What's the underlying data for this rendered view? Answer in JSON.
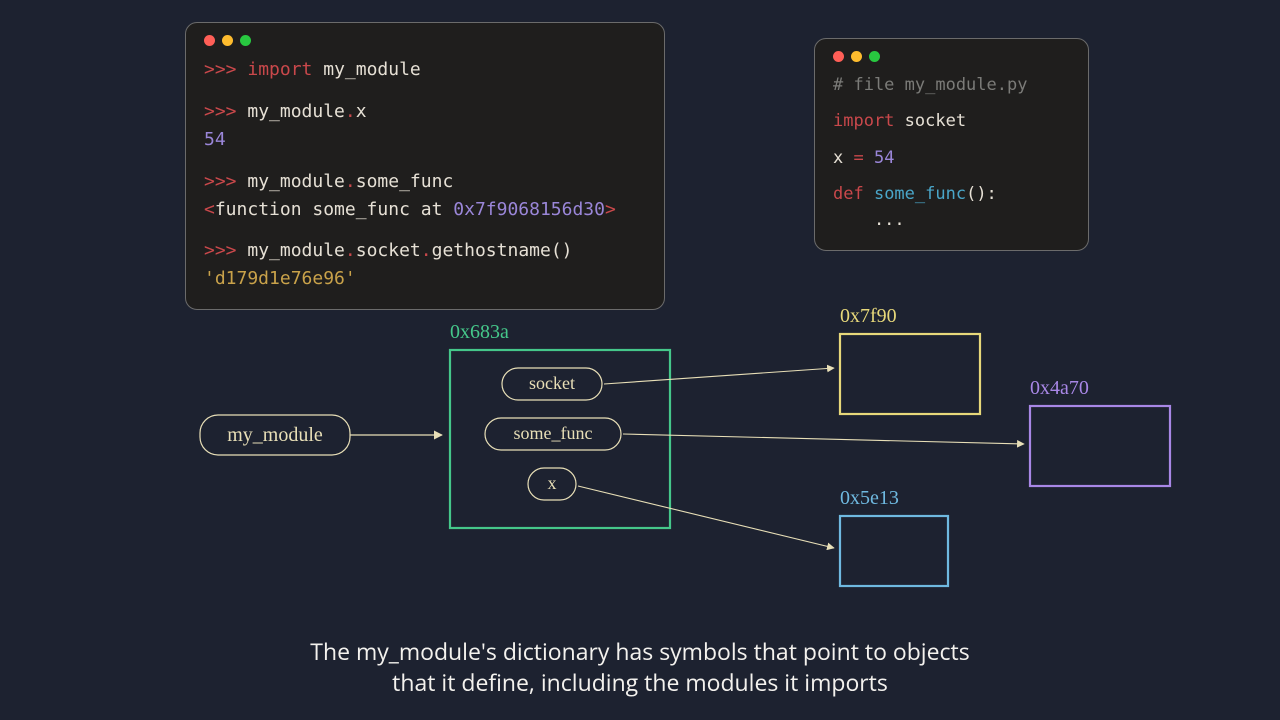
{
  "caption": {
    "line1": "The my_module's dictionary has symbols that point to objects",
    "line2": "that it define, including the modules it imports"
  },
  "repl": {
    "line1": {
      "prompt": ">>> ",
      "kw": "import",
      "rest": " my_module"
    },
    "line2": {
      "prompt": ">>> ",
      "expr": "my_module",
      "dot": ".",
      "attr": "x"
    },
    "line2_out": "54",
    "line3": {
      "prompt": ">>> ",
      "expr": "my_module",
      "dot": ".",
      "attr": "some_func"
    },
    "line3_out": {
      "lt": "<",
      "mid": "function some_func at ",
      "addr": "0x7f9068156d30",
      "gt": ">"
    },
    "line4": {
      "prompt": ">>> ",
      "expr": "my_module",
      "dot1": ".",
      "attr1": "socket",
      "dot2": ".",
      "call": "gethostname",
      "paren": "()"
    },
    "line4_out": "'d179d1e76e96'"
  },
  "file": {
    "comment": "# file my_module.py",
    "imp": {
      "kw": "import",
      "mod": " socket"
    },
    "assign": {
      "name": "x ",
      "op": "=",
      "val": " 54"
    },
    "def": {
      "kw": "def",
      "name": " some_func",
      "sig": "():"
    },
    "body": "    ..."
  },
  "diagram": {
    "module_label": "my_module",
    "dict_addr": "0x683a",
    "entries": {
      "socket": "socket",
      "some_func": "some_func",
      "x": "x"
    },
    "boxes": {
      "yellow_addr": "0x7f90",
      "purple_addr": "0x4a70",
      "blue_addr": "0x5e13"
    }
  }
}
